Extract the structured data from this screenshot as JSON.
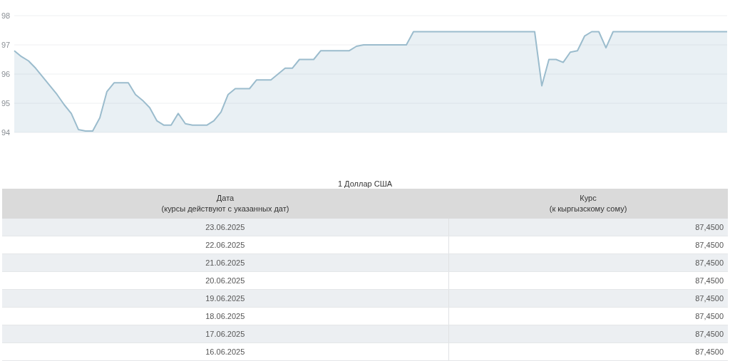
{
  "chart": {
    "chart_data": {
      "type": "area",
      "ylim": [
        94,
        98
      ],
      "yticks": [
        94,
        95,
        96,
        97,
        98
      ],
      "grid": true,
      "series": [
        {
          "color": "#9bbccd",
          "values": [
            96.8,
            96.6,
            96.45,
            96.2,
            95.9,
            95.6,
            95.3,
            94.95,
            94.65,
            94.1,
            94.05,
            94.05,
            94.5,
            95.4,
            95.7,
            95.7,
            95.7,
            95.3,
            95.1,
            94.85,
            94.4,
            94.25,
            94.25,
            94.65,
            94.3,
            94.25,
            94.25,
            94.25,
            94.4,
            94.7,
            95.3,
            95.5,
            95.5,
            95.5,
            95.8,
            95.8,
            95.8,
            96.0,
            96.2,
            96.2,
            96.5,
            96.5,
            96.5,
            96.8,
            96.8,
            96.8,
            96.8,
            96.8,
            96.95,
            97.0,
            97.0,
            97.0,
            97.0,
            97.0,
            97.0,
            97.0,
            97.45,
            97.45,
            97.45,
            97.45,
            97.45,
            97.45,
            97.45,
            97.45,
            97.45,
            97.45,
            97.45,
            97.45,
            97.45,
            97.45,
            97.45,
            97.45,
            97.45,
            97.45,
            95.6,
            96.5,
            96.5,
            96.4,
            96.75,
            96.8,
            97.3,
            97.45,
            97.45,
            96.9,
            97.45,
            97.45,
            97.45,
            97.45,
            97.45,
            97.45,
            97.45,
            97.45,
            97.45,
            97.45,
            97.45,
            97.45,
            97.45,
            97.45,
            97.45,
            97.45,
            97.45
          ]
        }
      ]
    }
  },
  "table": {
    "title": "1 Доллар США",
    "columns": [
      {
        "label": "Дата",
        "note": "(курсы действуют с указанных дат)"
      },
      {
        "label": "Курс",
        "note": "(к кыргызскому сому)"
      }
    ],
    "rows": [
      {
        "date": "23.06.2025",
        "rate": "87,4500"
      },
      {
        "date": "22.06.2025",
        "rate": "87,4500"
      },
      {
        "date": "21.06.2025",
        "rate": "87,4500"
      },
      {
        "date": "20.06.2025",
        "rate": "87,4500"
      },
      {
        "date": "19.06.2025",
        "rate": "87,4500"
      },
      {
        "date": "18.06.2025",
        "rate": "87,4500"
      },
      {
        "date": "17.06.2025",
        "rate": "87,4500"
      },
      {
        "date": "16.06.2025",
        "rate": "87,4500"
      }
    ]
  }
}
